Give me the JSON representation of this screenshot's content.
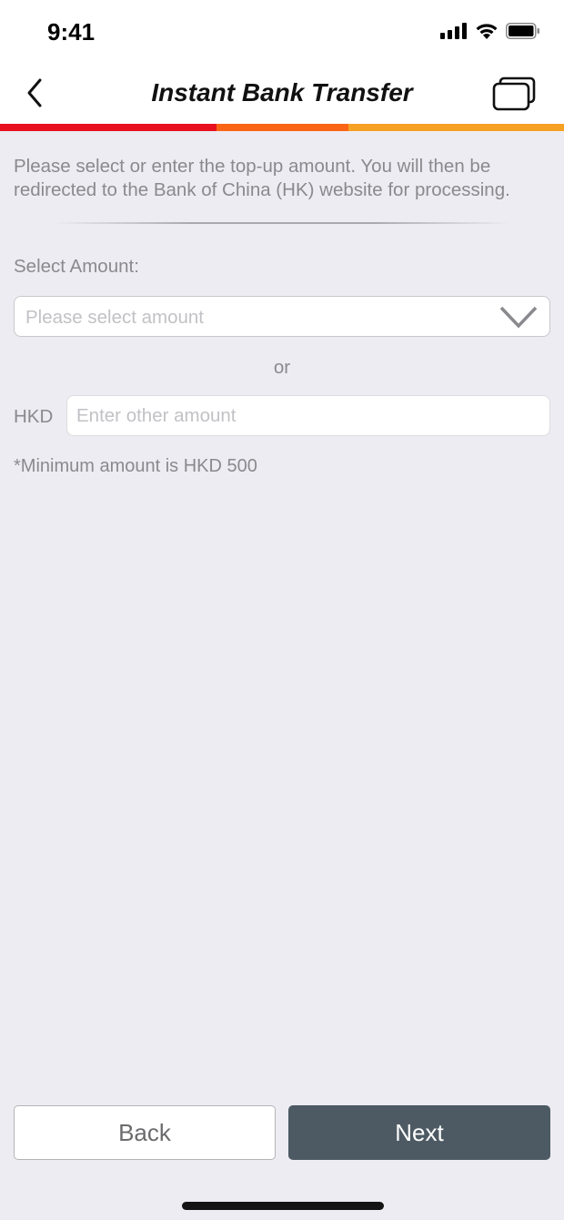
{
  "status_bar": {
    "time": "9:41",
    "icons": [
      "cellular-signal-icon",
      "wifi-icon",
      "battery-icon"
    ]
  },
  "nav": {
    "title": "Instant Bank Transfer",
    "back_icon": "chevron-left-icon",
    "right_icon": "windows-stack-icon"
  },
  "progress": {
    "steps": 3,
    "colors": [
      "#e8101e",
      "#fb6414",
      "#f6a124"
    ]
  },
  "content": {
    "intro": "Please select or enter the top-up amount. You will then be redirected to the Bank of China (HK) website for processing.",
    "select_label": "Select Amount:",
    "select_placeholder": "Please select amount",
    "or_text": "or",
    "currency_label": "HKD",
    "amount_placeholder": "Enter other amount",
    "amount_value": "",
    "minimum_note": "*Minimum amount is HKD 500"
  },
  "footer": {
    "back_label": "Back",
    "next_label": "Next",
    "next_color": "#4d5a63"
  }
}
